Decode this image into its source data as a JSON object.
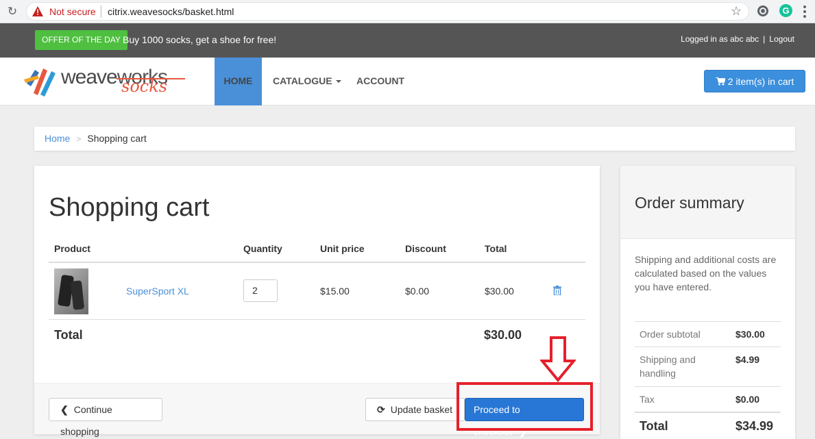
{
  "browser": {
    "security_label": "Not secure",
    "url": "citrix.weavesocks/basket.html",
    "extension_2_letter": "G"
  },
  "topbar": {
    "offer_badge": "OFFER OF THE DAY",
    "offer_text": "Buy 1000 socks, get a shoe for free!",
    "logged_in": "Logged in as abc abc",
    "separator": "|",
    "logout": "Logout"
  },
  "logo": {
    "weave": "weave",
    "works": "works",
    "socks": "socks"
  },
  "nav": {
    "home": "HOME",
    "catalogue": "CATALOGUE",
    "account": "ACCOUNT",
    "cart": "2 item(s) in cart"
  },
  "breadcrumb": {
    "home": "Home",
    "separator": ">",
    "current": "Shopping cart"
  },
  "cart": {
    "title": "Shopping cart",
    "headers": {
      "product": "Product",
      "quantity": "Quantity",
      "unit_price": "Unit price",
      "discount": "Discount",
      "total": "Total"
    },
    "items": [
      {
        "name": "SuperSport XL",
        "quantity": "2",
        "unit_price": "$15.00",
        "discount": "$0.00",
        "total": "$30.00"
      }
    ],
    "total_label": "Total",
    "total_value": "$30.00",
    "continue_label": "Continue shopping",
    "update_label": "Update basket",
    "checkout_label": "Proceed to checkout"
  },
  "summary": {
    "title": "Order summary",
    "note": "Shipping and additional costs are calculated based on the values you have entered.",
    "rows": [
      {
        "label": "Order subtotal",
        "value": "$30.00"
      },
      {
        "label": "Shipping and handling",
        "value": "$4.99"
      },
      {
        "label": "Tax",
        "value": "$0.00"
      },
      {
        "label": "Total",
        "value": "$34.99"
      }
    ]
  },
  "colors": {
    "accent": "#3b8fdc",
    "offer_green": "#4fbf40",
    "annotation_red": "#e5202b",
    "topbar": "#555555"
  }
}
